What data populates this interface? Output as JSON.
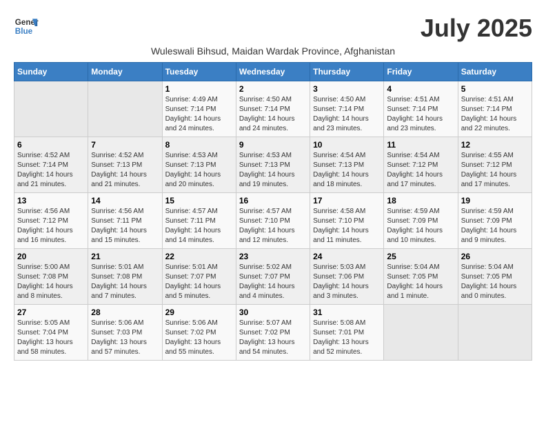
{
  "header": {
    "logo_general": "General",
    "logo_blue": "Blue",
    "month_title": "July 2025",
    "subtitle": "Wuleswali Bihsud, Maidan Wardak Province, Afghanistan"
  },
  "days_of_week": [
    "Sunday",
    "Monday",
    "Tuesday",
    "Wednesday",
    "Thursday",
    "Friday",
    "Saturday"
  ],
  "weeks": [
    [
      {
        "day": "",
        "info": ""
      },
      {
        "day": "",
        "info": ""
      },
      {
        "day": "1",
        "info": "Sunrise: 4:49 AM\nSunset: 7:14 PM\nDaylight: 14 hours\nand 24 minutes."
      },
      {
        "day": "2",
        "info": "Sunrise: 4:50 AM\nSunset: 7:14 PM\nDaylight: 14 hours\nand 24 minutes."
      },
      {
        "day": "3",
        "info": "Sunrise: 4:50 AM\nSunset: 7:14 PM\nDaylight: 14 hours\nand 23 minutes."
      },
      {
        "day": "4",
        "info": "Sunrise: 4:51 AM\nSunset: 7:14 PM\nDaylight: 14 hours\nand 23 minutes."
      },
      {
        "day": "5",
        "info": "Sunrise: 4:51 AM\nSunset: 7:14 PM\nDaylight: 14 hours\nand 22 minutes."
      }
    ],
    [
      {
        "day": "6",
        "info": "Sunrise: 4:52 AM\nSunset: 7:14 PM\nDaylight: 14 hours\nand 21 minutes."
      },
      {
        "day": "7",
        "info": "Sunrise: 4:52 AM\nSunset: 7:13 PM\nDaylight: 14 hours\nand 21 minutes."
      },
      {
        "day": "8",
        "info": "Sunrise: 4:53 AM\nSunset: 7:13 PM\nDaylight: 14 hours\nand 20 minutes."
      },
      {
        "day": "9",
        "info": "Sunrise: 4:53 AM\nSunset: 7:13 PM\nDaylight: 14 hours\nand 19 minutes."
      },
      {
        "day": "10",
        "info": "Sunrise: 4:54 AM\nSunset: 7:13 PM\nDaylight: 14 hours\nand 18 minutes."
      },
      {
        "day": "11",
        "info": "Sunrise: 4:54 AM\nSunset: 7:12 PM\nDaylight: 14 hours\nand 17 minutes."
      },
      {
        "day": "12",
        "info": "Sunrise: 4:55 AM\nSunset: 7:12 PM\nDaylight: 14 hours\nand 17 minutes."
      }
    ],
    [
      {
        "day": "13",
        "info": "Sunrise: 4:56 AM\nSunset: 7:12 PM\nDaylight: 14 hours\nand 16 minutes."
      },
      {
        "day": "14",
        "info": "Sunrise: 4:56 AM\nSunset: 7:11 PM\nDaylight: 14 hours\nand 15 minutes."
      },
      {
        "day": "15",
        "info": "Sunrise: 4:57 AM\nSunset: 7:11 PM\nDaylight: 14 hours\nand 14 minutes."
      },
      {
        "day": "16",
        "info": "Sunrise: 4:57 AM\nSunset: 7:10 PM\nDaylight: 14 hours\nand 12 minutes."
      },
      {
        "day": "17",
        "info": "Sunrise: 4:58 AM\nSunset: 7:10 PM\nDaylight: 14 hours\nand 11 minutes."
      },
      {
        "day": "18",
        "info": "Sunrise: 4:59 AM\nSunset: 7:09 PM\nDaylight: 14 hours\nand 10 minutes."
      },
      {
        "day": "19",
        "info": "Sunrise: 4:59 AM\nSunset: 7:09 PM\nDaylight: 14 hours\nand 9 minutes."
      }
    ],
    [
      {
        "day": "20",
        "info": "Sunrise: 5:00 AM\nSunset: 7:08 PM\nDaylight: 14 hours\nand 8 minutes."
      },
      {
        "day": "21",
        "info": "Sunrise: 5:01 AM\nSunset: 7:08 PM\nDaylight: 14 hours\nand 7 minutes."
      },
      {
        "day": "22",
        "info": "Sunrise: 5:01 AM\nSunset: 7:07 PM\nDaylight: 14 hours\nand 5 minutes."
      },
      {
        "day": "23",
        "info": "Sunrise: 5:02 AM\nSunset: 7:07 PM\nDaylight: 14 hours\nand 4 minutes."
      },
      {
        "day": "24",
        "info": "Sunrise: 5:03 AM\nSunset: 7:06 PM\nDaylight: 14 hours\nand 3 minutes."
      },
      {
        "day": "25",
        "info": "Sunrise: 5:04 AM\nSunset: 7:05 PM\nDaylight: 14 hours\nand 1 minute."
      },
      {
        "day": "26",
        "info": "Sunrise: 5:04 AM\nSunset: 7:05 PM\nDaylight: 14 hours\nand 0 minutes."
      }
    ],
    [
      {
        "day": "27",
        "info": "Sunrise: 5:05 AM\nSunset: 7:04 PM\nDaylight: 13 hours\nand 58 minutes."
      },
      {
        "day": "28",
        "info": "Sunrise: 5:06 AM\nSunset: 7:03 PM\nDaylight: 13 hours\nand 57 minutes."
      },
      {
        "day": "29",
        "info": "Sunrise: 5:06 AM\nSunset: 7:02 PM\nDaylight: 13 hours\nand 55 minutes."
      },
      {
        "day": "30",
        "info": "Sunrise: 5:07 AM\nSunset: 7:02 PM\nDaylight: 13 hours\nand 54 minutes."
      },
      {
        "day": "31",
        "info": "Sunrise: 5:08 AM\nSunset: 7:01 PM\nDaylight: 13 hours\nand 52 minutes."
      },
      {
        "day": "",
        "info": ""
      },
      {
        "day": "",
        "info": ""
      }
    ]
  ]
}
